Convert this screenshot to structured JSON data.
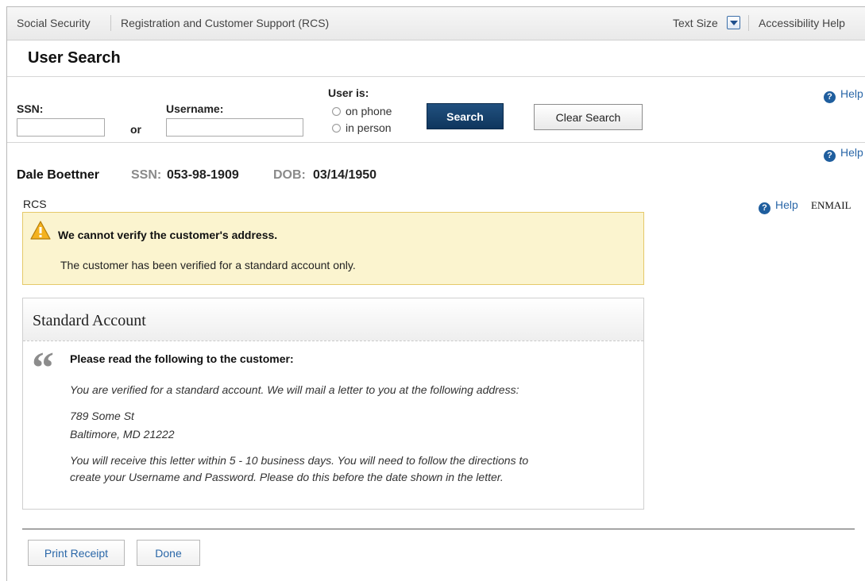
{
  "topbar": {
    "app_name": "Social Security",
    "section": "Registration and Customer Support (RCS)",
    "text_size_label": "Text Size",
    "accessibility_help": "Accessibility Help"
  },
  "page": {
    "title": "User Search"
  },
  "search": {
    "ssn_label": "SSN:",
    "or_label": "or",
    "username_label": "Username:",
    "ssn_value": "",
    "username_value": "",
    "user_is_label": "User is:",
    "radio_phone": "on phone",
    "radio_person": "in person",
    "search_button": "Search",
    "clear_button": "Clear Search"
  },
  "help": {
    "label": "Help",
    "icon": "question-circle-icon"
  },
  "customer": {
    "name": "Dale Boettner",
    "ssn_label": "SSN:",
    "ssn": "053-98-1909",
    "dob_label": "DOB:",
    "dob": "03/14/1950"
  },
  "rcs_label": "RCS",
  "enmail": "ENMAIL",
  "warning": {
    "title": "We cannot verify the customer's address.",
    "body": "The customer has been verified for a standard account only."
  },
  "account": {
    "title": "Standard Account",
    "read_title": "Please read the following to the customer:",
    "para1": "You are verified for a standard account. We will mail a letter to you at the following address:",
    "address_line1": "789 Some St",
    "address_line2": "Baltimore, MD 21222",
    "para2_line1": "You will receive this letter within 5 - 10 business days. You will need to follow the directions to",
    "para2_line2": "create your Username and Password. Please do this before the date shown in the letter."
  },
  "footer": {
    "print_receipt": "Print Receipt",
    "done": "Done"
  },
  "colors": {
    "primary_button": "#0f365d",
    "warning_bg": "#fbf4cf",
    "link": "#2a67a8"
  }
}
